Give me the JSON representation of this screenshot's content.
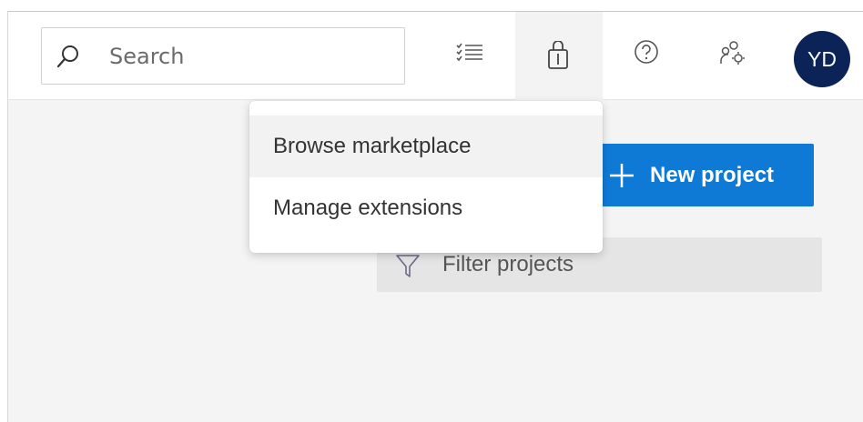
{
  "header": {
    "search": {
      "placeholder": "Search"
    },
    "icons": [
      "search-icon",
      "work-items-icon",
      "marketplace-bag-icon",
      "help-icon",
      "user-settings-icon"
    ],
    "avatar_initials": "YD"
  },
  "marketplace_menu": {
    "items": [
      {
        "label": "Browse marketplace"
      },
      {
        "label": "Manage extensions"
      }
    ]
  },
  "main": {
    "new_project_label": "New project",
    "filter_placeholder": "Filter projects"
  },
  "colors": {
    "accent": "#0f7ad6",
    "avatar_bg": "#0b2357",
    "page_bg": "#f4f4f4"
  }
}
